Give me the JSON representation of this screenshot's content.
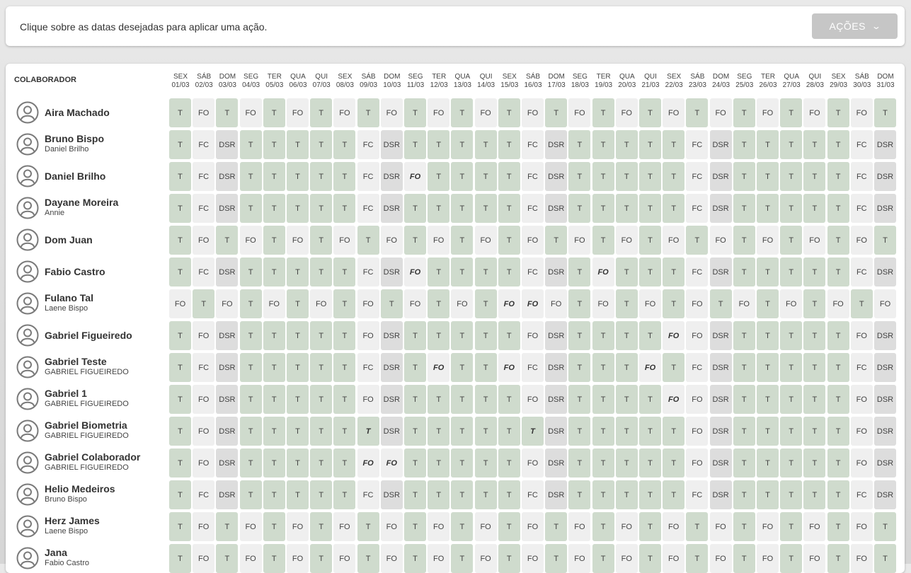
{
  "topbar": {
    "instruction": "Clique sobre as datas desejadas para aplicar uma ação.",
    "actions_label": "AÇÕES"
  },
  "grid": {
    "collaborator_header": "COLABORADOR",
    "days": [
      {
        "dow": "SEX",
        "date": "01/03"
      },
      {
        "dow": "SÁB",
        "date": "02/03"
      },
      {
        "dow": "DOM",
        "date": "03/03"
      },
      {
        "dow": "SEG",
        "date": "04/03"
      },
      {
        "dow": "TER",
        "date": "05/03"
      },
      {
        "dow": "QUA",
        "date": "06/03"
      },
      {
        "dow": "QUI",
        "date": "07/03"
      },
      {
        "dow": "SEX",
        "date": "08/03"
      },
      {
        "dow": "SÁB",
        "date": "09/03"
      },
      {
        "dow": "DOM",
        "date": "10/03"
      },
      {
        "dow": "SEG",
        "date": "11/03"
      },
      {
        "dow": "TER",
        "date": "12/03"
      },
      {
        "dow": "QUA",
        "date": "13/03"
      },
      {
        "dow": "QUI",
        "date": "14/03"
      },
      {
        "dow": "SEX",
        "date": "15/03"
      },
      {
        "dow": "SÁB",
        "date": "16/03"
      },
      {
        "dow": "DOM",
        "date": "17/03"
      },
      {
        "dow": "SEG",
        "date": "18/03"
      },
      {
        "dow": "TER",
        "date": "19/03"
      },
      {
        "dow": "QUA",
        "date": "20/03"
      },
      {
        "dow": "QUI",
        "date": "21/03"
      },
      {
        "dow": "SEX",
        "date": "22/03"
      },
      {
        "dow": "SÁB",
        "date": "23/03"
      },
      {
        "dow": "DOM",
        "date": "24/03"
      },
      {
        "dow": "SEG",
        "date": "25/03"
      },
      {
        "dow": "TER",
        "date": "26/03"
      },
      {
        "dow": "QUA",
        "date": "27/03"
      },
      {
        "dow": "QUI",
        "date": "28/03"
      },
      {
        "dow": "SEX",
        "date": "29/03"
      },
      {
        "dow": "SÁB",
        "date": "30/03"
      },
      {
        "dow": "DOM",
        "date": "31/03"
      }
    ],
    "rows": [
      {
        "name": "Aira Machado",
        "sub": "",
        "cells": [
          "T",
          "FO",
          "T",
          "FO",
          "T",
          "FO",
          "T",
          "FO",
          "T",
          "FO",
          "T",
          "FO",
          "T",
          "FO",
          "T",
          "FO",
          "T",
          "FO",
          "T",
          "FO",
          "T",
          "FO",
          "T",
          "FO",
          "T",
          "FO",
          "T",
          "FO",
          "T",
          "FO",
          "T"
        ]
      },
      {
        "name": "Bruno Bispo",
        "sub": "Daniel Brilho",
        "cells": [
          "T",
          "FC",
          "DSR",
          "T",
          "T",
          "T",
          "T",
          "T",
          "FC",
          "DSR",
          "T",
          "T",
          "T",
          "T",
          "T",
          "FC",
          "DSR",
          "T",
          "T",
          "T",
          "T",
          "T",
          "FC",
          "DSR",
          "T",
          "T",
          "T",
          "T",
          "T",
          "FC",
          "DSR"
        ]
      },
      {
        "name": "Daniel Brilho",
        "sub": "",
        "cells": [
          "T",
          "FC",
          "DSR",
          "T",
          "T",
          "T",
          "T",
          "T",
          "FC",
          "DSR",
          "FO*",
          "T",
          "T",
          "T",
          "T",
          "FC",
          "DSR",
          "T",
          "T",
          "T",
          "T",
          "T",
          "FC",
          "DSR",
          "T",
          "T",
          "T",
          "T",
          "T",
          "FC",
          "DSR"
        ]
      },
      {
        "name": "Dayane Moreira",
        "sub": "Annie",
        "cells": [
          "T",
          "FC",
          "DSR",
          "T",
          "T",
          "T",
          "T",
          "T",
          "FC",
          "DSR",
          "T",
          "T",
          "T",
          "T",
          "T",
          "FC",
          "DSR",
          "T",
          "T",
          "T",
          "T",
          "T",
          "FC",
          "DSR",
          "T",
          "T",
          "T",
          "T",
          "T",
          "FC",
          "DSR"
        ]
      },
      {
        "name": "Dom Juan",
        "sub": "",
        "cells": [
          "T",
          "FO",
          "T",
          "FO",
          "T",
          "FO",
          "T",
          "FO",
          "T",
          "FO",
          "T",
          "FO",
          "T",
          "FO",
          "T",
          "FO",
          "T",
          "FO",
          "T",
          "FO",
          "T",
          "FO",
          "T",
          "FO",
          "T",
          "FO",
          "T",
          "FO",
          "T",
          "FO",
          "T"
        ]
      },
      {
        "name": "Fabio Castro",
        "sub": "",
        "cells": [
          "T",
          "FC",
          "DSR",
          "T",
          "T",
          "T",
          "T",
          "T",
          "FC",
          "DSR",
          "FO*",
          "T",
          "T",
          "T",
          "T",
          "FC",
          "DSR",
          "T",
          "FO*",
          "T",
          "T",
          "T",
          "FC",
          "DSR",
          "T",
          "T",
          "T",
          "T",
          "T",
          "FC",
          "DSR"
        ]
      },
      {
        "name": "Fulano Tal",
        "sub": "Laene Bispo",
        "cells": [
          "FO",
          "T",
          "FO",
          "T",
          "FO",
          "T",
          "FO",
          "T",
          "FO",
          "T",
          "FO",
          "T",
          "FO",
          "T",
          "FO*",
          "FO*",
          "FO",
          "T",
          "FO",
          "T",
          "FO",
          "T",
          "FO",
          "T",
          "FO",
          "T",
          "FO",
          "T",
          "FO",
          "T",
          "FO"
        ]
      },
      {
        "name": "Gabriel Figueiredo",
        "sub": "",
        "cells": [
          "T",
          "FO",
          "DSR",
          "T",
          "T",
          "T",
          "T",
          "T",
          "FO",
          "DSR",
          "T",
          "T",
          "T",
          "T",
          "T",
          "FO",
          "DSR",
          "T",
          "T",
          "T",
          "T",
          "FO*",
          "FO",
          "DSR",
          "T",
          "T",
          "T",
          "T",
          "T",
          "FO",
          "DSR"
        ]
      },
      {
        "name": "Gabriel Teste",
        "sub": "GABRIEL FIGUEIREDO",
        "cells": [
          "T",
          "FC",
          "DSR",
          "T",
          "T",
          "T",
          "T",
          "T",
          "FC",
          "DSR",
          "T",
          "FO*",
          "T",
          "T",
          "FO*",
          "FC",
          "DSR",
          "T",
          "T",
          "T",
          "FO*",
          "T",
          "FC",
          "DSR",
          "T",
          "T",
          "T",
          "T",
          "T",
          "FC",
          "DSR"
        ]
      },
      {
        "name": "Gabriel 1",
        "sub": "GABRIEL FIGUEIREDO",
        "cells": [
          "T",
          "FO",
          "DSR",
          "T",
          "T",
          "T",
          "T",
          "T",
          "FO",
          "DSR",
          "T",
          "T",
          "T",
          "T",
          "T",
          "FO",
          "DSR",
          "T",
          "T",
          "T",
          "T",
          "FO*",
          "FO",
          "DSR",
          "T",
          "T",
          "T",
          "T",
          "T",
          "FO",
          "DSR"
        ]
      },
      {
        "name": "Gabriel Biometria",
        "sub": "GABRIEL FIGUEIREDO",
        "cells": [
          "T",
          "FO",
          "DSR",
          "T",
          "T",
          "T",
          "T",
          "T",
          "T*",
          "DSR",
          "T",
          "T",
          "T",
          "T",
          "T",
          "T*",
          "DSR",
          "T",
          "T",
          "T",
          "T",
          "T",
          "FO",
          "DSR",
          "T",
          "T",
          "T",
          "T",
          "T",
          "FO",
          "DSR"
        ]
      },
      {
        "name": "Gabriel Colaborador",
        "sub": "GABRIEL FIGUEIREDO",
        "cells": [
          "T",
          "FO",
          "DSR",
          "T",
          "T",
          "T",
          "T",
          "T",
          "FO*",
          "FO*",
          "T",
          "T",
          "T",
          "T",
          "T",
          "FO",
          "DSR",
          "T",
          "T",
          "T",
          "T",
          "T",
          "FO",
          "DSR",
          "T",
          "T",
          "T",
          "T",
          "T",
          "FO",
          "DSR"
        ]
      },
      {
        "name": "Helio Medeiros",
        "sub": "Bruno Bispo",
        "cells": [
          "T",
          "FC",
          "DSR",
          "T",
          "T",
          "T",
          "T",
          "T",
          "FC",
          "DSR",
          "T",
          "T",
          "T",
          "T",
          "T",
          "FC",
          "DSR",
          "T",
          "T",
          "T",
          "T",
          "T",
          "FC",
          "DSR",
          "T",
          "T",
          "T",
          "T",
          "T",
          "FC",
          "DSR"
        ]
      },
      {
        "name": "Herz James",
        "sub": "Laene Bispo",
        "cells": [
          "T",
          "FO",
          "T",
          "FO",
          "T",
          "FO",
          "T",
          "FO",
          "T",
          "FO",
          "T",
          "FO",
          "T",
          "FO",
          "T",
          "FO",
          "T",
          "FO",
          "T",
          "FO",
          "T",
          "FO",
          "T",
          "FO",
          "T",
          "FO",
          "T",
          "FO",
          "T",
          "FO",
          "T"
        ]
      },
      {
        "name": "Jana",
        "sub": "Fabio Castro",
        "cells": [
          "T",
          "FO",
          "T",
          "FO",
          "T",
          "FO",
          "T",
          "FO",
          "T",
          "FO",
          "T",
          "FO",
          "T",
          "FO",
          "T",
          "FO",
          "T",
          "FO",
          "T",
          "FO",
          "T",
          "FO",
          "T",
          "FO",
          "T",
          "FO",
          "T",
          "FO",
          "T",
          "FO",
          "T"
        ]
      }
    ]
  },
  "colors": {
    "work_cell": "#cfdbcd",
    "off_cell": "#efefef",
    "dsr_cell": "#dddddd",
    "actions_button": "#c6c6c6"
  }
}
